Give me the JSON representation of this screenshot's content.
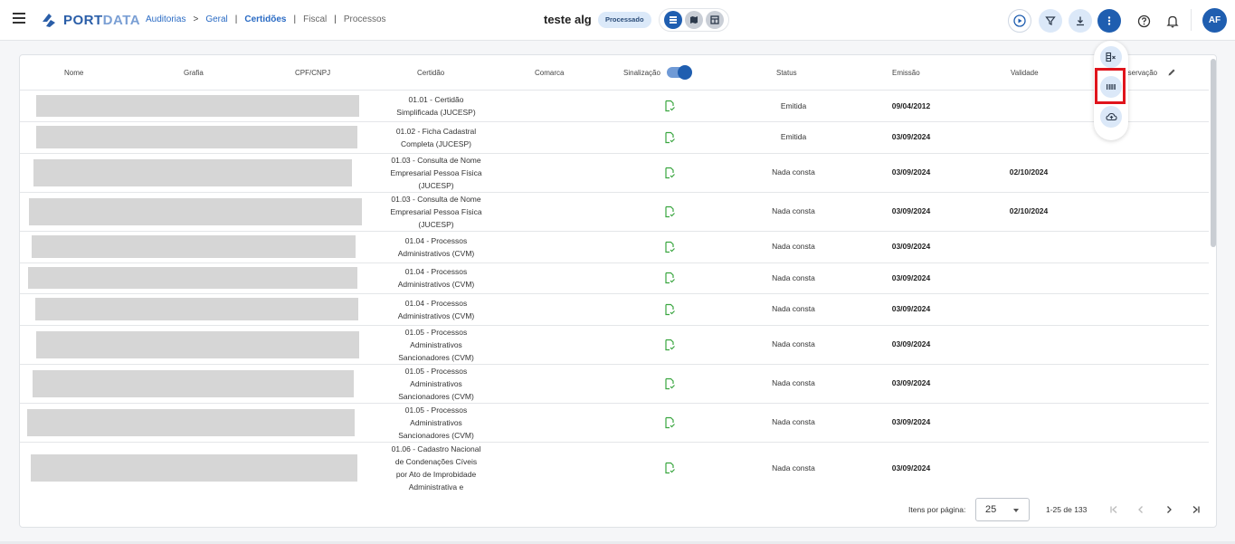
{
  "header": {
    "logo": {
      "text_bold": "PORT",
      "text_light": "DATA"
    },
    "breadcrumb": [
      {
        "label": "Auditorias"
      },
      {
        "label": "Geral"
      },
      {
        "label": "Certidões"
      },
      {
        "label": "Fiscal"
      },
      {
        "label": "Processos"
      }
    ],
    "breadcrumb_separators": [
      ">",
      "|",
      "|",
      "|"
    ],
    "title": "teste alg",
    "status": "Processado",
    "user_initials": "AF",
    "view_icons": [
      "list-view-icon",
      "map-view-icon",
      "grid-view-icon"
    ],
    "action_icons": [
      "play-icon",
      "filter-icon",
      "download-icon",
      "more-vertical-icon",
      "help-icon",
      "bell-icon"
    ]
  },
  "fab_menu": {
    "items": [
      "clear-columns-icon",
      "barcode-icon",
      "cloud-upload-icon"
    ],
    "highlighted": "barcode-icon"
  },
  "table": {
    "columns": {
      "nome": "Nome",
      "grafia": "Grafia",
      "cpf_cnpj": "CPF/CNPJ",
      "certidao": "Certidão",
      "comarca": "Comarca",
      "sinalizacao": "Sinalização",
      "status": "Status",
      "emissao": "Emissão",
      "validade": "Validade",
      "observacao": "Observação"
    },
    "sinalizacao_toggle": true,
    "rows": [
      {
        "certidao": [
          "01.01 - Certidão",
          "Simplificada (JUCESP)"
        ],
        "status": "Emitida",
        "emissao": "09/04/2012",
        "validade": ""
      },
      {
        "certidao": [
          "01.02 - Ficha Cadastral",
          "Completa (JUCESP)"
        ],
        "status": "Emitida",
        "emissao": "03/09/2024",
        "validade": ""
      },
      {
        "certidao": [
          "01.03 - Consulta de Nome",
          "Empresarial Pessoa Física",
          "(JUCESP)"
        ],
        "status": "Nada consta",
        "emissao": "03/09/2024",
        "validade": "02/10/2024"
      },
      {
        "certidao": [
          "01.03 - Consulta de Nome",
          "Empresarial Pessoa Física",
          "(JUCESP)"
        ],
        "status": "Nada consta",
        "emissao": "03/09/2024",
        "validade": "02/10/2024"
      },
      {
        "certidao": [
          "01.04 - Processos",
          "Administrativos (CVM)"
        ],
        "status": "Nada consta",
        "emissao": "03/09/2024",
        "validade": ""
      },
      {
        "certidao": [
          "01.04 - Processos",
          "Administrativos (CVM)"
        ],
        "status": "Nada consta",
        "emissao": "03/09/2024",
        "validade": ""
      },
      {
        "certidao": [
          "01.04 - Processos",
          "Administrativos (CVM)"
        ],
        "status": "Nada consta",
        "emissao": "03/09/2024",
        "validade": ""
      },
      {
        "certidao": [
          "01.05 - Processos",
          "Administrativos",
          "Sancionadores (CVM)"
        ],
        "status": "Nada consta",
        "emissao": "03/09/2024",
        "validade": ""
      },
      {
        "certidao": [
          "01.05 - Processos",
          "Administrativos",
          "Sancionadores (CVM)"
        ],
        "status": "Nada consta",
        "emissao": "03/09/2024",
        "validade": ""
      },
      {
        "certidao": [
          "01.05 - Processos",
          "Administrativos",
          "Sancionadores (CVM)"
        ],
        "status": "Nada consta",
        "emissao": "03/09/2024",
        "validade": ""
      },
      {
        "certidao": [
          "01.06 - Cadastro Nacional",
          "de Condenações Cíveis",
          "por Ato de Improbidade",
          "Administrativa e"
        ],
        "status": "Nada consta",
        "emissao": "03/09/2024",
        "validade": ""
      }
    ]
  },
  "pagination": {
    "label": "Itens por página:",
    "page_size": "25",
    "range": "1-25 de 133"
  },
  "colors": {
    "primary": "#1f5eb0",
    "light_primary": "#dbe8f8",
    "highlight": "#e0141c",
    "doc_icon": "#3aa640"
  }
}
